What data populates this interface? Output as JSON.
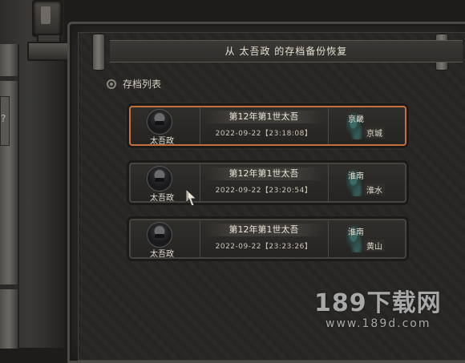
{
  "dialog": {
    "title": "从 太吾政 的存档备份恢复"
  },
  "section": {
    "label": "存档列表",
    "icon": "list-bullet-icon"
  },
  "saves": [
    {
      "character": "太吾政",
      "generation": "第12年第1世太吾",
      "timestamp": "2022-09-22【23:18:08】",
      "region": "京畿",
      "city": "京城",
      "selected": true
    },
    {
      "character": "太吾政",
      "generation": "第12年第1世太吾",
      "timestamp": "2022-09-22【23:20:54】",
      "region": "淮南",
      "city": "淮水",
      "selected": false
    },
    {
      "character": "太吾政",
      "generation": "第12年第1世太吾",
      "timestamp": "2022-09-22【23:23:26】",
      "region": "淮南",
      "city": "黄山",
      "selected": false
    }
  ],
  "watermark": {
    "main": "189下载网",
    "url": "www.189d.com"
  },
  "colors": {
    "selected_border": "#c4703a",
    "panel_bg": "#272624"
  }
}
